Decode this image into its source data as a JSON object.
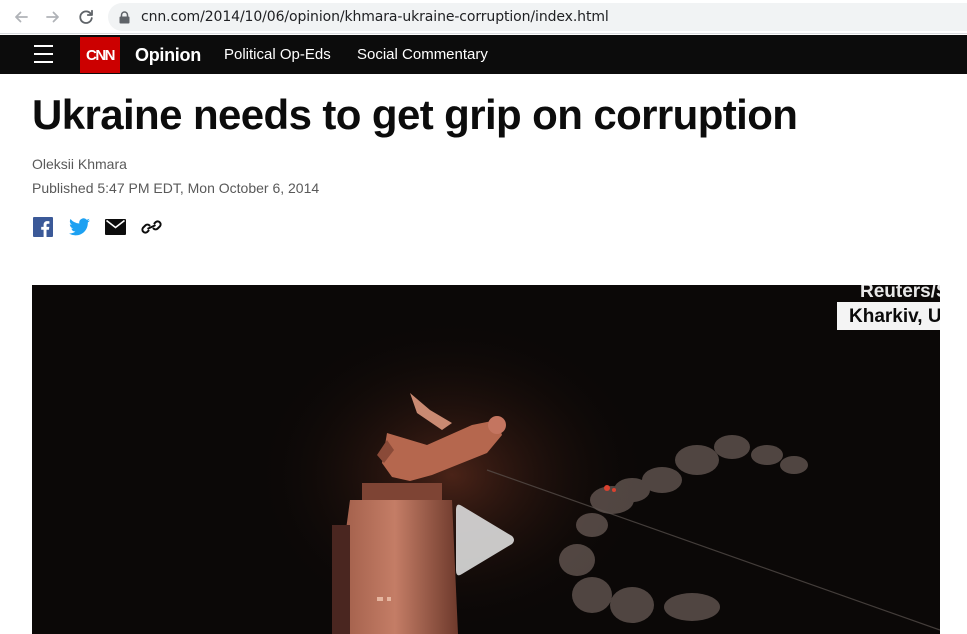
{
  "browser": {
    "url": "cnn.com/2014/10/06/opinion/khmara-ukraine-corruption/index.html",
    "back_icon": "arrow-left-icon",
    "forward_icon": "arrow-right-icon",
    "reload_icon": "reload-icon",
    "lock_icon": "lock-icon"
  },
  "nav": {
    "logo": "CNN",
    "section": "Opinion",
    "links": [
      "Political Op-Eds",
      "Social Commentary"
    ],
    "menu_icon": "hamburger-menu-icon",
    "brand_color": "#cc0000"
  },
  "article": {
    "headline": "Ukraine needs to get grip on corruption",
    "author": "Oleksii Khmara",
    "published": "Published 5:47 PM EDT, Mon October 6, 2014",
    "share_icons": [
      "facebook-icon",
      "twitter-icon",
      "email-icon",
      "link-icon"
    ]
  },
  "video": {
    "caption_source": "Reuters/S",
    "caption_location": "Kharkiv, U",
    "play_icon": "play-icon"
  }
}
